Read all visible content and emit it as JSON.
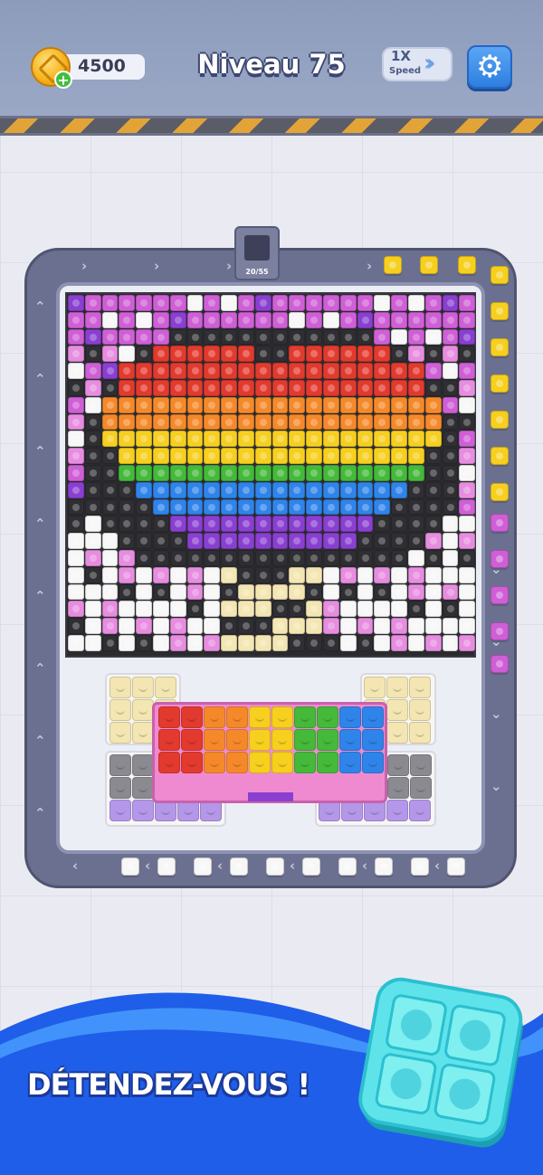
{
  "header": {
    "coins": "4500",
    "level_title": "Niveau 75",
    "speed_value": "1X",
    "speed_label": "Speed"
  },
  "board": {
    "counter": "20/55"
  },
  "footer": {
    "slogan": "DÉTENDEZ-VOUS !"
  },
  "colors": {
    "pink": "#e78de0",
    "magenta": "#cf5fd6",
    "purple": "#8a3fd1",
    "white": "#f7f7f7",
    "black": "#2e2e33",
    "red": "#e23a2e",
    "orange": "#f5892a",
    "yellow": "#f6cf1f",
    "green": "#45b93a",
    "blue": "#2f84ea",
    "cream": "#f3e6b2",
    "gray": "#8a8a90",
    "lavender": "#b497e8"
  },
  "icons": [
    "coin-icon",
    "plus-icon",
    "fast-forward-icon",
    "gear-icon",
    "teal-block-icon"
  ]
}
